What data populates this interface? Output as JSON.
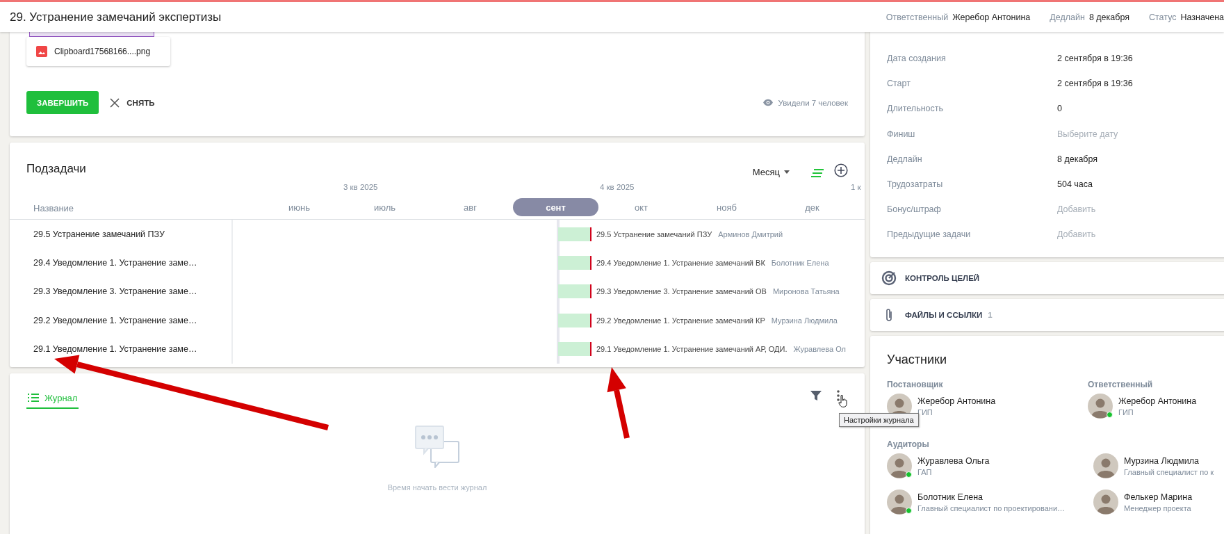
{
  "header": {
    "title": "29. Устранение замечаний экспертизы",
    "fields": [
      {
        "label": "Ответственный",
        "value": "Жеребор Антонина"
      },
      {
        "label": "Дедлайн",
        "value": "8 декабря"
      },
      {
        "label": "Статус",
        "value": "Назначена"
      }
    ]
  },
  "attachment": {
    "file_name": "Clipboard17568166....png"
  },
  "actions": {
    "complete": "ЗАВЕРШИТЬ",
    "remove": "СНЯТЬ",
    "views": "Увидели 7 человек"
  },
  "subtasks": {
    "title": "Подзадачи",
    "scale": "Месяц",
    "name_column": "Название",
    "quarters": [
      {
        "months": [
          {
            "label": "июнь",
            "selected": false
          }
        ]
      },
      {
        "label": "3 кв 2025",
        "months": [
          {
            "label": "июль",
            "selected": false
          },
          {
            "label": "авг",
            "selected": false
          },
          {
            "label": "сент",
            "selected": true
          }
        ]
      },
      {
        "label": "4 кв 2025",
        "months": [
          {
            "label": "окт",
            "selected": false
          },
          {
            "label": "нояб",
            "selected": false
          },
          {
            "label": "дек",
            "selected": false
          }
        ]
      },
      {
        "label": "1 к"
      }
    ],
    "rows": [
      {
        "name": "29.5 Устранение замечаний ПЗУ",
        "bar_label": "29.5 Устранение замечаний ПЗУ",
        "assignee": "Арминов Дмитрий"
      },
      {
        "name": "29.4 Уведомление 1. Устранение заме…",
        "bar_label": "29.4 Уведомление 1. Устранение замечаний ВК",
        "assignee": "Болотник Елена"
      },
      {
        "name": "29.3 Уведомление 3. Устранение заме…",
        "bar_label": "29.3 Уведомление 3. Устранение замечаний ОВ",
        "assignee": "Миронова Татьяна"
      },
      {
        "name": "29.2 Уведомление 1. Устранение заме…",
        "bar_label": "29.2 Уведомление 1. Устранение замечаний КР",
        "assignee": "Мурзина Людмила"
      },
      {
        "name": "29.1 Уведомление 1. Устранение заме…",
        "bar_label": "29.1 Уведомление 1. Устранение замечаний АР, ОДИ.",
        "assignee": "Журавлева Ол"
      }
    ]
  },
  "journal": {
    "tab": {
      "label": "Журнал",
      "selected": true
    },
    "empty_text": "Время начать вести журнал",
    "tooltip": "Настройки журнала"
  },
  "details": [
    {
      "label": "Дата создания",
      "value": "2 сентября в 19:36",
      "kind": "value"
    },
    {
      "label": "Старт",
      "value": "2 сентября в 19:36",
      "kind": "value"
    },
    {
      "label": "Длительность",
      "value": "0",
      "kind": "value"
    },
    {
      "label": "Финиш",
      "value": "Выберите дату",
      "kind": "placeholder"
    },
    {
      "label": "Дедлайн",
      "value": "8 декабря",
      "kind": "value"
    },
    {
      "label": "Трудозатраты",
      "value": "504 часа",
      "kind": "value"
    },
    {
      "label": "Бонус/штраф",
      "value": "Добавить",
      "kind": "placeholder"
    },
    {
      "label": "Предыдущие задачи",
      "value": "Добавить",
      "kind": "placeholder"
    }
  ],
  "sections": [
    {
      "kind": "goals",
      "label": "КОНТРОЛЬ ЦЕЛЕЙ"
    },
    {
      "kind": "files",
      "label": "ФАЙЛЫ И ССЫЛКИ",
      "count": "1"
    }
  ],
  "participants": {
    "title": "Участники",
    "roles": [
      {
        "label": "Постановщик",
        "people": [
          {
            "name": "Жеребор Антонина",
            "role": "ГИП",
            "online": false
          }
        ]
      },
      {
        "label": "Ответственный",
        "people": [
          {
            "name": "Жеребор Антонина",
            "role": "ГИП",
            "online": true
          }
        ]
      }
    ],
    "auditors_label": "Аудиторы",
    "auditors": [
      {
        "name": "Журавлева Ольга",
        "role": "ГАП",
        "online": true
      },
      {
        "name": "Мурзина Людмила",
        "role": "Главный специалист по к",
        "online": false
      },
      {
        "name": "Болотник Елена",
        "role": "Главный специалист по проектировани…",
        "online": true
      },
      {
        "name": "Фелькер Марина",
        "role": "Менеджер проекта",
        "online": false
      }
    ]
  }
}
